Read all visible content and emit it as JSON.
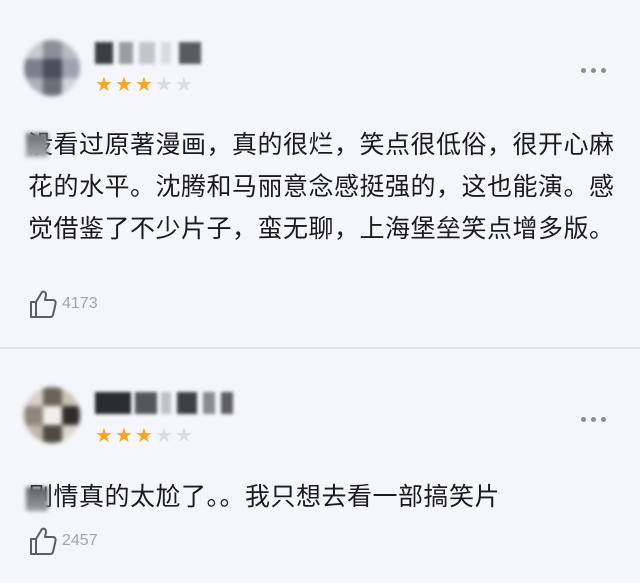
{
  "reviews": [
    {
      "rating": 3,
      "max_rating": 5,
      "text": "没看过原著漫画，真的很烂，笑点很低俗，很开心麻花的水平。沈腾和马丽意念感挺强的，这也能演。感觉借鉴了不少片子，蛮无聊，上海堡垒笑点增多版。",
      "likes": "4173",
      "icons": {
        "like": "thumbs-up-icon",
        "more": "more-dots-icon",
        "star": "star-icon"
      }
    },
    {
      "rating": 3,
      "max_rating": 5,
      "text": "剧情真的太尬了。。我只想去看一部搞笑片",
      "likes": "2457",
      "icons": {
        "like": "thumbs-up-icon",
        "more": "more-dots-icon",
        "star": "star-icon"
      }
    }
  ],
  "colors": {
    "background": "#f5f6fa",
    "star_filled": "#f5a623",
    "star_empty": "#dcdde2",
    "text": "#1b1b1f",
    "muted": "#a3a4a9"
  }
}
